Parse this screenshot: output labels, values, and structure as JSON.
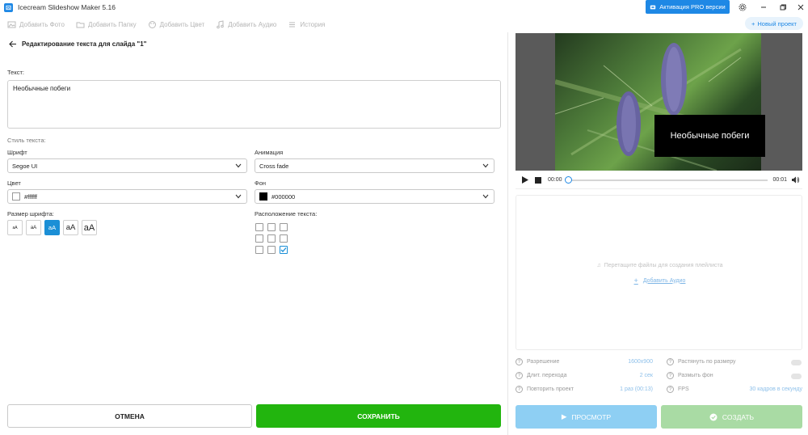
{
  "titlebar": {
    "title": "Icecream Slideshow Maker 5.16",
    "pro_label": "Активация PRO версии"
  },
  "toolbar": {
    "items": [
      "Добавить Фото",
      "Добавить Папку",
      "Добавить Цвет",
      "Добавить Аудио",
      "История"
    ],
    "new_project": "Новый проект"
  },
  "editor": {
    "back_title": "Редактирование текста для слайда \"1\"",
    "text_label": "Текст:",
    "text_value": "Необычные побеги",
    "style_label": "Стиль текста:",
    "font_label": "Шрифт",
    "font_value": "Segoe UI",
    "animation_label": "Анимация",
    "animation_value": "Cross fade",
    "color_label": "Цвет",
    "color_value": "#ffffff",
    "bg_label": "Фон",
    "bg_value": "#000000",
    "font_size_label": "Размер шрифта:",
    "font_sizes": [
      "aA",
      "aA",
      "aA",
      "aA",
      "aA"
    ],
    "font_size_selected": 2,
    "position_label": "Расположение текста:",
    "position_selected": 8,
    "cancel": "ОТМЕНА",
    "save": "СОХРАНИТЬ"
  },
  "preview": {
    "caption": "Необычные побеги",
    "time_start": "00:00",
    "time_end": "00:01",
    "progress": 0
  },
  "playlist": {
    "hint": "Перетащите файлы для создания плейлиста",
    "add_audio": "Добавить Аудио"
  },
  "settings": {
    "resolution_label": "Разрешение",
    "resolution_value": "1600x900",
    "transition_label": "Длит. перехода",
    "transition_value": "2 сек",
    "repeat_label": "Повторить проект",
    "repeat_value": "1 раз (00:13)",
    "stretch_label": "Растянуть по размеру",
    "blur_label": "Размыть фон",
    "fps_label": "FPS",
    "fps_value": "30 кадров в секунду"
  },
  "actions": {
    "preview": "ПРОСМОТР",
    "create": "СОЗДАТЬ"
  },
  "colors": {
    "accent": "#1e88e5",
    "save": "#22b50e",
    "preview_btn": "#8ecff3",
    "create_btn": "#a9dba4"
  }
}
